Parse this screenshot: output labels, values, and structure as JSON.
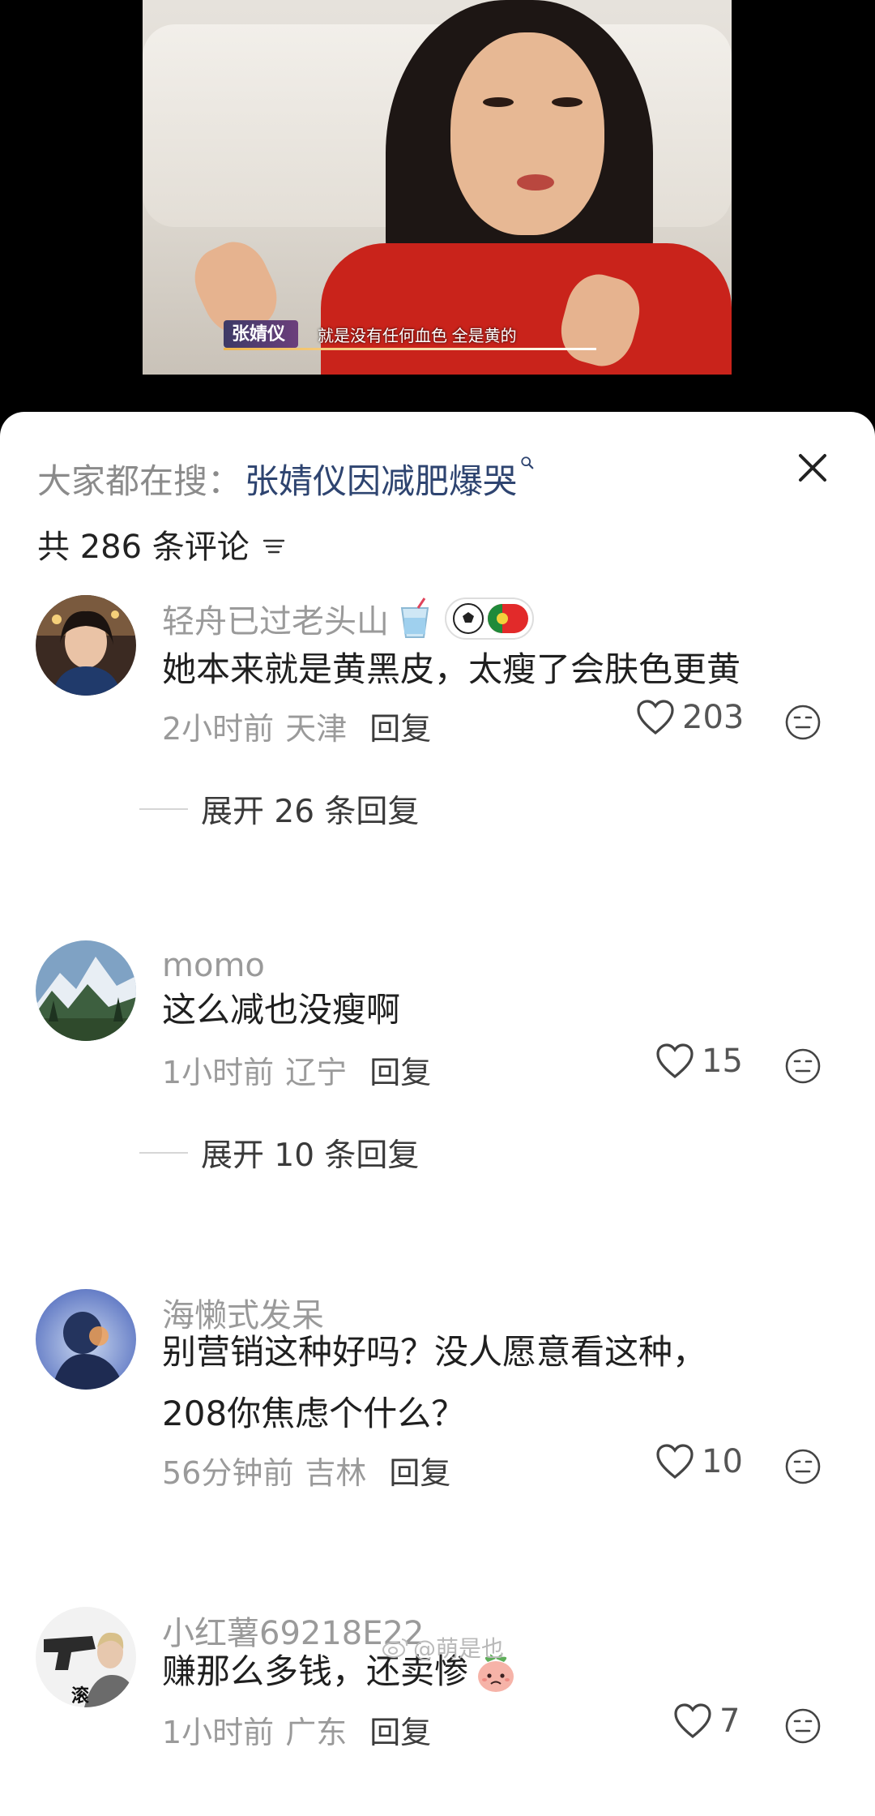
{
  "video": {
    "caption_name": "张婧仪",
    "caption_text": "就是没有任何血色  全是黄的"
  },
  "panel": {
    "search_prefix": "大家都在搜：",
    "search_query": "张婧仪因减肥爆哭",
    "comment_count": "共 286 条评论"
  },
  "comments": [
    {
      "username": "轻舟已过老头山",
      "text": "她本来就是黄黑皮，太瘦了会肤色更黄",
      "time": "2小时前",
      "location": "天津",
      "reply_label": "回复",
      "likes": "203",
      "expand": "展开 26 条回复"
    },
    {
      "username": "momo",
      "text": "这么减也没瘦啊",
      "time": "1小时前",
      "location": "辽宁",
      "reply_label": "回复",
      "likes": "15",
      "expand": "展开 10 条回复"
    },
    {
      "username": "海懒式发呆",
      "text_line1": "别营销这种好吗？没人愿意看这种，",
      "text_line2": "208你焦虑个什么？",
      "time": "56分钟前",
      "location": "吉林",
      "reply_label": "回复",
      "likes": "10"
    },
    {
      "username": "小红薯69218E22",
      "text": "赚那么多钱，还卖惨",
      "time": "1小时前",
      "location": "广东",
      "reply_label": "回复",
      "likes": "7"
    }
  ],
  "watermark": "@萌是也",
  "avatar4_text": "滚"
}
